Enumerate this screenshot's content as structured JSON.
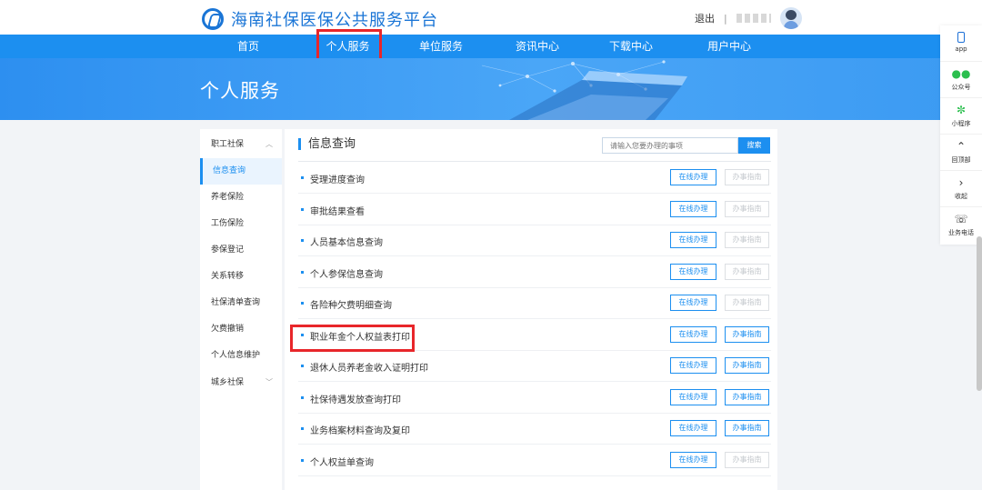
{
  "header": {
    "site_title": "海南社保医保公共服务平台",
    "logout": "退出",
    "separator": "|"
  },
  "nav": {
    "items": [
      "首页",
      "个人服务",
      "单位服务",
      "资讯中心",
      "下载中心",
      "用户中心"
    ],
    "active_index": 1
  },
  "banner": {
    "title": "个人服务"
  },
  "sidebar": {
    "group_1": "职工社保",
    "items": [
      "信息查询",
      "养老保险",
      "工伤保险",
      "参保登记",
      "关系转移",
      "社保清单查询",
      "欠费撤销",
      "个人信息维护"
    ],
    "active_index": 0,
    "group_2": "城乡社保"
  },
  "main": {
    "title": "信息查询",
    "search_placeholder": "请输入您要办理的事项",
    "search_button": "搜索",
    "online_label": "在线办理",
    "guide_label": "办事指南",
    "rows": [
      {
        "label": "受理进度查询",
        "guide_enabled": false
      },
      {
        "label": "审批结果查看",
        "guide_enabled": false
      },
      {
        "label": "人员基本信息查询",
        "guide_enabled": false
      },
      {
        "label": "个人参保信息查询",
        "guide_enabled": false
      },
      {
        "label": "各险种欠费明细查询",
        "guide_enabled": false
      },
      {
        "label": "职业年金个人权益表打印",
        "guide_enabled": true
      },
      {
        "label": "退休人员养老金收入证明打印",
        "guide_enabled": true
      },
      {
        "label": "社保待遇发放查询打印",
        "guide_enabled": true
      },
      {
        "label": "业务档案材料查询及复印",
        "guide_enabled": true
      },
      {
        "label": "个人权益单查询",
        "guide_enabled": false
      }
    ]
  },
  "floatbar": {
    "items": [
      {
        "label": "app",
        "icon": "phone-icon"
      },
      {
        "label": "公众号",
        "icon": "wechat-icon"
      },
      {
        "label": "小程序",
        "icon": "mini-program-icon"
      },
      {
        "label": "回顶部",
        "icon": "chevron-up-icon"
      },
      {
        "label": "收起",
        "icon": "chevron-right-icon"
      },
      {
        "label": "业务电话",
        "icon": "telephone-icon"
      }
    ]
  },
  "colors": {
    "primary": "#1c8ff0",
    "highlight": "#e8262a",
    "brand": "#1a75d6"
  }
}
